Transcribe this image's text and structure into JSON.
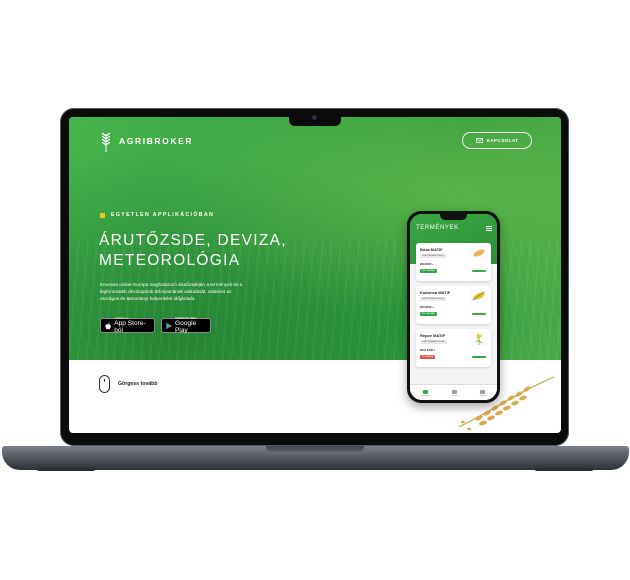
{
  "site": {
    "brand": "AGRIBROKER",
    "contact_label": "KAPCSOLAT",
    "tagline": "EGYETLEN APPLIKÁCIÓBAN",
    "headline_line1": "ÁRUTŐZSDE, DEVIZA,",
    "headline_line2": "METEOROLÓGIA",
    "description": "Kövesse online Európa meghatározó árutőzsdéjén a termények és a legfontosabb devizapárok árfolyamának alakulását, valamint az országos és tartományi helyenként időjárását.",
    "appstore_small": "Letöltés az",
    "appstore_big": "App Store-ból",
    "googleplay_small": "SZEREZD MEG:",
    "googleplay_big": "Google Play",
    "scroll_label": "Görgess tovább"
  },
  "phone": {
    "title": "TERMÉNYEK",
    "cards": [
      {
        "name": "Búza MATIF",
        "tag": "SZEPTEMBER 9ELEC",
        "price": "209 EUR",
        "trend": "+",
        "badge": "FEL KALBÁN",
        "badge_color": "#2fa84a"
      },
      {
        "name": "Kukorica MATIF",
        "tag": "SZEPTEMBER 9ELET",
        "price": "203 EUR",
        "trend": "+",
        "badge": "FEL KALBÁN",
        "badge_color": "#2fa84a"
      },
      {
        "name": "Repce MATIF",
        "tag": "SZEPTEMBER 9ELMA",
        "price": "5014 EUR",
        "trend": "+",
        "badge": "LE KALBÁN",
        "badge_color": "#e3524a"
      }
    ],
    "tabs": [
      "Termények",
      "Deviza",
      "Időjárás"
    ]
  },
  "colors": {
    "hero_green": "#3aa543",
    "accent_yellow": "#f3c419",
    "laptop_frame": "#0b0b0c"
  }
}
